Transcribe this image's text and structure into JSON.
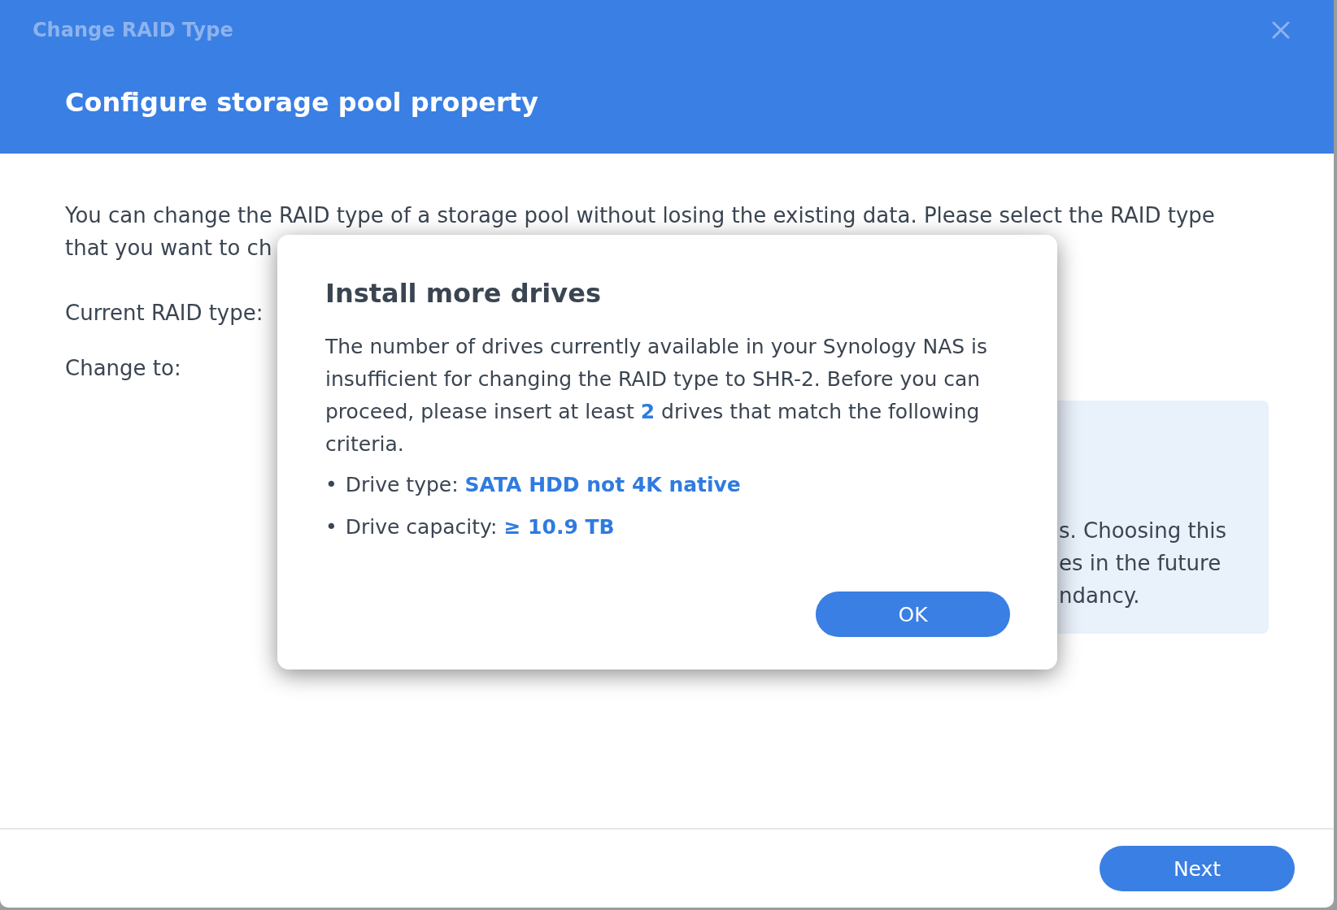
{
  "window": {
    "title": "Change RAID Type",
    "heading": "Configure storage pool property"
  },
  "intro_lines": [
    "You can change the RAID type of a storage pool without losing the existing data. Please select the RAID type",
    "that you want to ch"
  ],
  "fields": [
    {
      "label": "Current RAID type:"
    },
    {
      "label": "Change to:"
    }
  ],
  "info_lines": [
    "s. Choosing this",
    "es in the future",
    "ndancy."
  ],
  "dialog": {
    "title": "Install more drives",
    "message": "The number of drives currently available in your Synology NAS is insufficient for changing the RAID type to SHR-2. Before you can proceed, please insert at least **2** drives that match the following criteria.",
    "criteria": [
      {
        "bullet": "•",
        "text": "Drive type: **SATA HDD not 4K native**"
      },
      {
        "bullet": "•",
        "text": "Drive capacity: **≥ 10.9 TB**"
      }
    ],
    "button": "OK"
  },
  "footer": {
    "button": "Next"
  }
}
